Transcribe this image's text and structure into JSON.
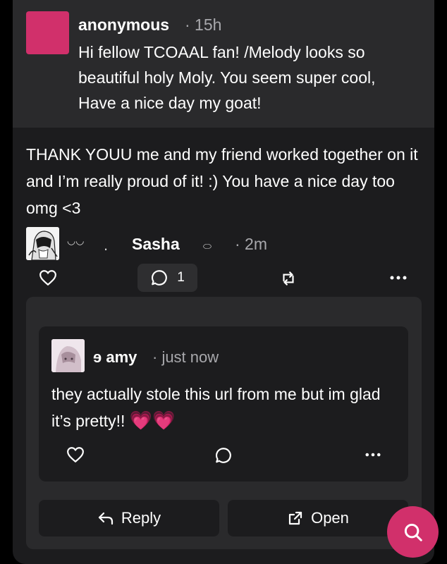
{
  "ask": {
    "name": "anonymous",
    "time": "· 15h",
    "text": "Hi fellow TCOAAL fan! /Melody looks so beautiful holy Moly. You seem super cool, Have a nice day my goat!"
  },
  "answer": {
    "text": "THANK YOUU me and my friend worked together on it and I’m really proud of it! :) You have a nice day too omg <3"
  },
  "author": {
    "deco_left": "◡◡",
    "deco_dot": ".",
    "name": "Sasha",
    "deco_right": "⬭",
    "time": "· 2m"
  },
  "post_actions": {
    "reply_count": "1"
  },
  "comment": {
    "name": "ɘ amy",
    "time": "· just now",
    "text": "they actually stole this url from me but im glad it’s pretty!!",
    "emoji": "💗💗"
  },
  "buttons": {
    "reply": "Reply",
    "open": "Open"
  },
  "colors": {
    "accent": "#d1306b",
    "background": "#000000",
    "card": "#1c1c1e",
    "secondary_text": "#a8a8ac"
  }
}
